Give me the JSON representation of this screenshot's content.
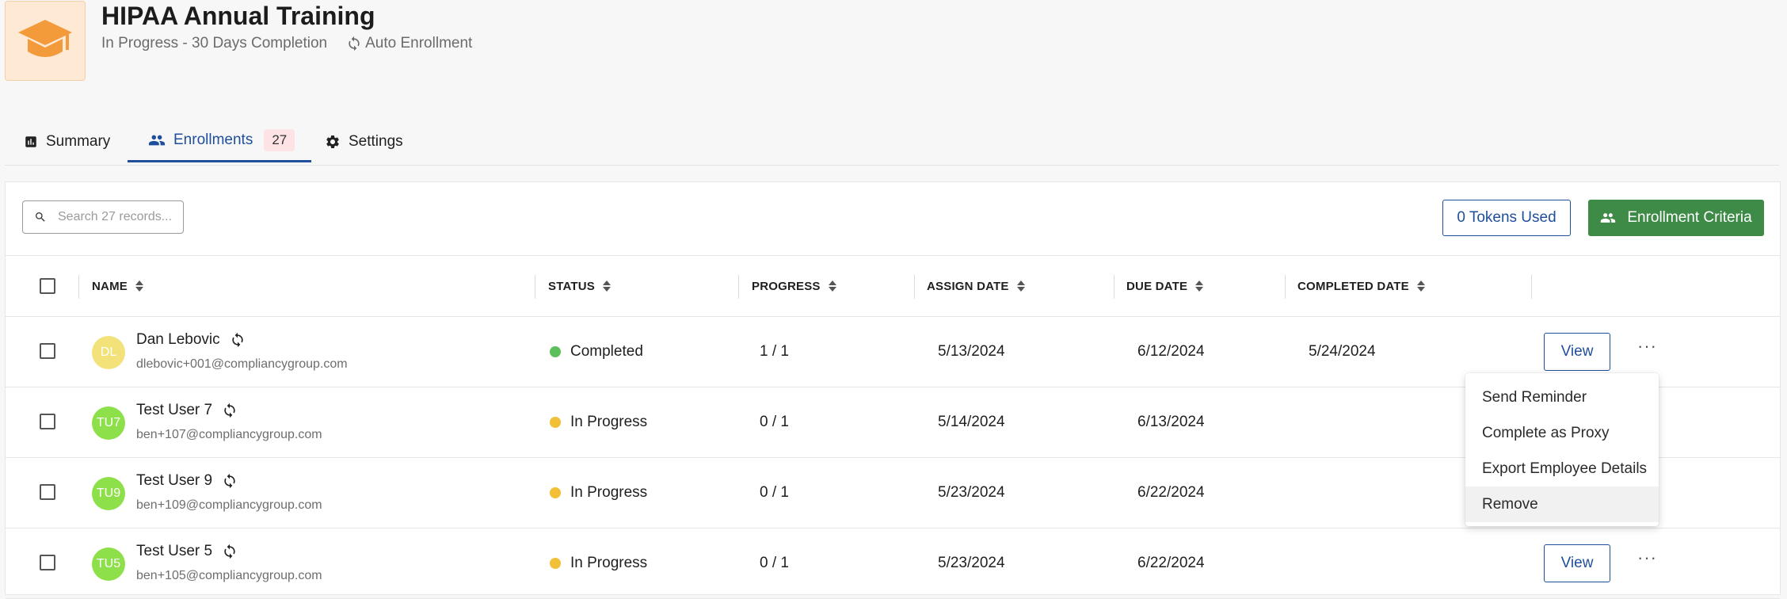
{
  "course": {
    "icon": "graduation-cap-icon",
    "title": "HIPAA Annual Training",
    "status_line": "In Progress - 30 Days Completion",
    "enrollment_type": "Auto Enrollment"
  },
  "tabs": [
    {
      "label": "Summary",
      "icon": "bar-chart-icon",
      "active": false
    },
    {
      "label": "Enrollments",
      "icon": "people-icon",
      "active": true,
      "count": "27"
    },
    {
      "label": "Settings",
      "icon": "gear-icon",
      "active": false
    }
  ],
  "toolbar": {
    "search_placeholder": "Search 27 records...",
    "tokens_label": "0 Tokens Used",
    "criteria_label": "Enrollment Criteria"
  },
  "table": {
    "columns": [
      "NAME",
      "STATUS",
      "PROGRESS",
      "ASSIGN DATE",
      "DUE DATE",
      "COMPLETED DATE"
    ],
    "rows": [
      {
        "initials": "DL",
        "avatar_color": "#f3e27a",
        "name": "Dan Lebovic",
        "email": "dlebovic+001@compliancygroup.com",
        "status": "Completed",
        "status_color": "#5cbf5c",
        "progress": "1 / 1",
        "assign_date": "5/13/2024",
        "due_date": "6/12/2024",
        "completed_date": "5/24/2024",
        "view_label": "View",
        "more": "···"
      },
      {
        "initials": "TU7",
        "avatar_color": "#8ee04a",
        "name": "Test User 7",
        "email": "ben+107@compliancygroup.com",
        "status": "In Progress",
        "status_color": "#f2c037",
        "progress": "0 / 1",
        "assign_date": "5/14/2024",
        "due_date": "6/13/2024",
        "completed_date": ""
      },
      {
        "initials": "TU9",
        "avatar_color": "#8ee04a",
        "name": "Test User 9",
        "email": "ben+109@compliancygroup.com",
        "status": "In Progress",
        "status_color": "#f2c037",
        "progress": "0 / 1",
        "assign_date": "5/23/2024",
        "due_date": "6/22/2024",
        "completed_date": ""
      },
      {
        "initials": "TU5",
        "avatar_color": "#8ee04a",
        "name": "Test User 5",
        "email": "ben+105@compliancygroup.com",
        "status": "In Progress",
        "status_color": "#f2c037",
        "progress": "0 / 1",
        "assign_date": "5/23/2024",
        "due_date": "6/22/2024",
        "completed_date": "",
        "view_label": "View",
        "more": "···"
      }
    ]
  },
  "row_menu": {
    "items": [
      "Send Reminder",
      "Complete as Proxy",
      "Export Employee Details",
      "Remove"
    ],
    "highlighted": "Remove"
  },
  "colors": {
    "accent": "#1f4f9a",
    "success": "#3e8b47"
  }
}
